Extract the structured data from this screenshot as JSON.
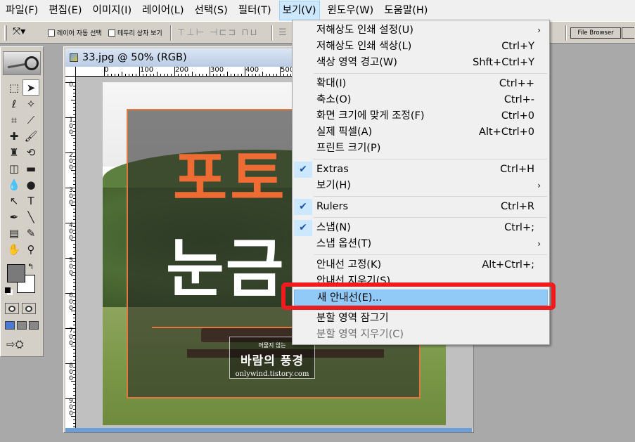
{
  "menubar": {
    "items": [
      {
        "label": "파일(F)"
      },
      {
        "label": "편집(E)"
      },
      {
        "label": "이미지(I)"
      },
      {
        "label": "레이어(L)"
      },
      {
        "label": "선택(S)"
      },
      {
        "label": "필터(T)"
      },
      {
        "label": "보기(V)",
        "active": true
      },
      {
        "label": "윈도우(W)"
      },
      {
        "label": "도움말(H)"
      }
    ]
  },
  "options_bar": {
    "tool_icon": "move-tool-icon",
    "auto_layer_label": "레이어 자동 선택",
    "bounding_box_label": "테두리 상자 보기",
    "file_browser_label": "File Browser"
  },
  "document": {
    "title": "33.jpg @ 50% (RGB)",
    "ruler_h": [
      "0",
      "100",
      "200",
      "300",
      "400",
      "500"
    ],
    "ruler_v": [
      "0",
      "1 0 0",
      "2 0 0",
      "3 0 0",
      "4 0 0",
      "5 0 0",
      "6 0 0",
      "7 0 0",
      "8 0 0",
      "9 0 0"
    ],
    "image_text": {
      "headline1": "포토",
      "headline2": "눈금",
      "badge_small": "머물지 않는",
      "badge_main": "바람의 풍경",
      "badge_url": "onlywind.tistory.com"
    }
  },
  "view_menu": {
    "items": [
      {
        "label": "저해상도 인쇄 설정(U)",
        "submenu": true
      },
      {
        "label": "저해상도 인쇄 색상(L)",
        "shortcut": "Ctrl+Y"
      },
      {
        "label": "색상 영역 경고(W)",
        "shortcut": "Shft+Ctrl+Y"
      },
      {
        "label": "확대(I)",
        "shortcut": "Ctrl++"
      },
      {
        "label": "축소(O)",
        "shortcut": "Ctrl+-"
      },
      {
        "label": "화면 크기에 맞게 조정(F)",
        "shortcut": "Ctrl+0"
      },
      {
        "label": "실제 픽셀(A)",
        "shortcut": "Alt+Ctrl+0"
      },
      {
        "label": "프린트 크기(P)"
      },
      {
        "label": "Extras",
        "shortcut": "Ctrl+H",
        "checked": true
      },
      {
        "label": "보기(H)",
        "submenu": true
      },
      {
        "label": "Rulers",
        "shortcut": "Ctrl+R",
        "checked": true
      },
      {
        "label": "스냅(N)",
        "shortcut": "Ctrl+;",
        "checked": true
      },
      {
        "label": "스냅 옵션(T)",
        "submenu": true
      },
      {
        "label": "안내선 고정(K)",
        "shortcut": "Alt+Ctrl+;"
      },
      {
        "label": "안내선 지우기(S)"
      },
      {
        "label": "새 안내선(E)...",
        "highlighted": true
      },
      {
        "label": "분할 영역 잠그기"
      },
      {
        "label": "분할 영역 지우기(C)",
        "disabled": true
      }
    ],
    "submenu_arrow": "›",
    "check_mark": "✔"
  },
  "colors": {
    "menu_highlight": "#91c9f7",
    "annotation_red": "#ee1c1c",
    "headline_orange": "#ee6b34"
  }
}
